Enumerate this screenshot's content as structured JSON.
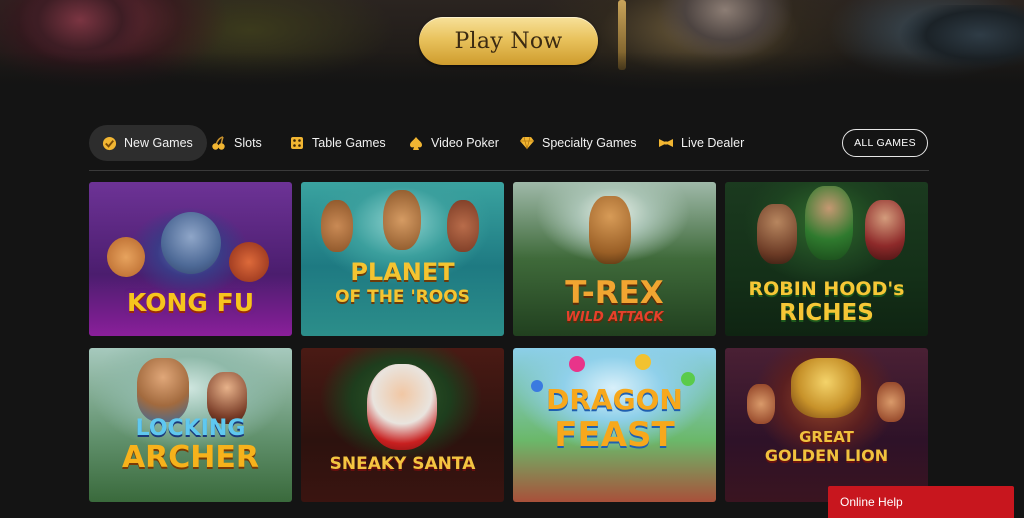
{
  "hero": {
    "play_label": "Play Now"
  },
  "nav": {
    "items": [
      {
        "label": "New Games",
        "icon": "new-games-icon",
        "active": true
      },
      {
        "label": "Slots",
        "icon": "cherries-icon",
        "active": false
      },
      {
        "label": "Table Games",
        "icon": "dice-icon",
        "active": false
      },
      {
        "label": "Video Poker",
        "icon": "spade-icon",
        "active": false
      },
      {
        "label": "Specialty Games",
        "icon": "diamond-icon",
        "active": false
      },
      {
        "label": "Live Dealer",
        "icon": "bowtie-icon",
        "active": false
      }
    ],
    "all_games_label": "ALL GAMES"
  },
  "games": [
    {
      "line1": "KONG FU",
      "line2": "",
      "accent": "#f6c51e"
    },
    {
      "line1": "PLANET",
      "line2": "OF THE 'ROOS",
      "accent": "#f5c431"
    },
    {
      "line1": "T-REX",
      "line2": "WILD ATTACK",
      "accent": "#f1a531"
    },
    {
      "line1": "ROBIN HOOD's",
      "line2": "RICHES",
      "accent": "#f6c736"
    },
    {
      "line1": "LOCKING",
      "line2": "ARCHER",
      "accent": "#f7b21b"
    },
    {
      "line1": "SNEAKY SANTA",
      "line2": "",
      "accent": "#f4c541"
    },
    {
      "line1": "DRAGON",
      "line2": "FEAST",
      "accent": "#f7a81c"
    },
    {
      "line1": "GREAT",
      "line2": "GOLDEN LION",
      "accent": "#f0c23e"
    }
  ],
  "help": {
    "label": "Online Help"
  },
  "colors": {
    "brand_gold": "#e9c35e",
    "help_red": "#c8161e",
    "page_bg": "#141414"
  }
}
